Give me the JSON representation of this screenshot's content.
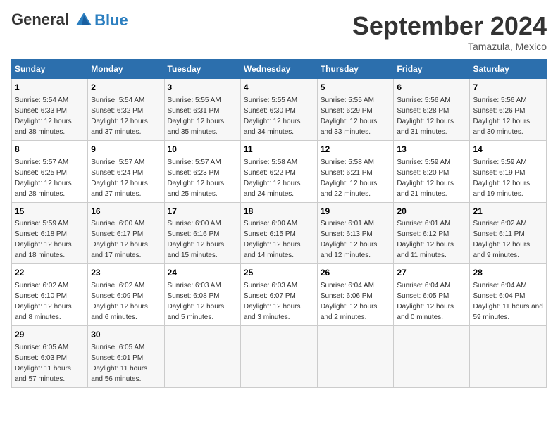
{
  "header": {
    "logo_line1": "General",
    "logo_line2": "Blue",
    "month": "September 2024",
    "location": "Tamazula, Mexico"
  },
  "weekdays": [
    "Sunday",
    "Monday",
    "Tuesday",
    "Wednesday",
    "Thursday",
    "Friday",
    "Saturday"
  ],
  "weeks": [
    [
      {
        "day": "1",
        "sunrise": "5:54 AM",
        "sunset": "6:33 PM",
        "daylight": "12 hours and 38 minutes."
      },
      {
        "day": "2",
        "sunrise": "5:54 AM",
        "sunset": "6:32 PM",
        "daylight": "12 hours and 37 minutes."
      },
      {
        "day": "3",
        "sunrise": "5:55 AM",
        "sunset": "6:31 PM",
        "daylight": "12 hours and 35 minutes."
      },
      {
        "day": "4",
        "sunrise": "5:55 AM",
        "sunset": "6:30 PM",
        "daylight": "12 hours and 34 minutes."
      },
      {
        "day": "5",
        "sunrise": "5:55 AM",
        "sunset": "6:29 PM",
        "daylight": "12 hours and 33 minutes."
      },
      {
        "day": "6",
        "sunrise": "5:56 AM",
        "sunset": "6:28 PM",
        "daylight": "12 hours and 31 minutes."
      },
      {
        "day": "7",
        "sunrise": "5:56 AM",
        "sunset": "6:26 PM",
        "daylight": "12 hours and 30 minutes."
      }
    ],
    [
      {
        "day": "8",
        "sunrise": "5:57 AM",
        "sunset": "6:25 PM",
        "daylight": "12 hours and 28 minutes."
      },
      {
        "day": "9",
        "sunrise": "5:57 AM",
        "sunset": "6:24 PM",
        "daylight": "12 hours and 27 minutes."
      },
      {
        "day": "10",
        "sunrise": "5:57 AM",
        "sunset": "6:23 PM",
        "daylight": "12 hours and 25 minutes."
      },
      {
        "day": "11",
        "sunrise": "5:58 AM",
        "sunset": "6:22 PM",
        "daylight": "12 hours and 24 minutes."
      },
      {
        "day": "12",
        "sunrise": "5:58 AM",
        "sunset": "6:21 PM",
        "daylight": "12 hours and 22 minutes."
      },
      {
        "day": "13",
        "sunrise": "5:59 AM",
        "sunset": "6:20 PM",
        "daylight": "12 hours and 21 minutes."
      },
      {
        "day": "14",
        "sunrise": "5:59 AM",
        "sunset": "6:19 PM",
        "daylight": "12 hours and 19 minutes."
      }
    ],
    [
      {
        "day": "15",
        "sunrise": "5:59 AM",
        "sunset": "6:18 PM",
        "daylight": "12 hours and 18 minutes."
      },
      {
        "day": "16",
        "sunrise": "6:00 AM",
        "sunset": "6:17 PM",
        "daylight": "12 hours and 17 minutes."
      },
      {
        "day": "17",
        "sunrise": "6:00 AM",
        "sunset": "6:16 PM",
        "daylight": "12 hours and 15 minutes."
      },
      {
        "day": "18",
        "sunrise": "6:00 AM",
        "sunset": "6:15 PM",
        "daylight": "12 hours and 14 minutes."
      },
      {
        "day": "19",
        "sunrise": "6:01 AM",
        "sunset": "6:13 PM",
        "daylight": "12 hours and 12 minutes."
      },
      {
        "day": "20",
        "sunrise": "6:01 AM",
        "sunset": "6:12 PM",
        "daylight": "12 hours and 11 minutes."
      },
      {
        "day": "21",
        "sunrise": "6:02 AM",
        "sunset": "6:11 PM",
        "daylight": "12 hours and 9 minutes."
      }
    ],
    [
      {
        "day": "22",
        "sunrise": "6:02 AM",
        "sunset": "6:10 PM",
        "daylight": "12 hours and 8 minutes."
      },
      {
        "day": "23",
        "sunrise": "6:02 AM",
        "sunset": "6:09 PM",
        "daylight": "12 hours and 6 minutes."
      },
      {
        "day": "24",
        "sunrise": "6:03 AM",
        "sunset": "6:08 PM",
        "daylight": "12 hours and 5 minutes."
      },
      {
        "day": "25",
        "sunrise": "6:03 AM",
        "sunset": "6:07 PM",
        "daylight": "12 hours and 3 minutes."
      },
      {
        "day": "26",
        "sunrise": "6:04 AM",
        "sunset": "6:06 PM",
        "daylight": "12 hours and 2 minutes."
      },
      {
        "day": "27",
        "sunrise": "6:04 AM",
        "sunset": "6:05 PM",
        "daylight": "12 hours and 0 minutes."
      },
      {
        "day": "28",
        "sunrise": "6:04 AM",
        "sunset": "6:04 PM",
        "daylight": "11 hours and 59 minutes."
      }
    ],
    [
      {
        "day": "29",
        "sunrise": "6:05 AM",
        "sunset": "6:03 PM",
        "daylight": "11 hours and 57 minutes."
      },
      {
        "day": "30",
        "sunrise": "6:05 AM",
        "sunset": "6:01 PM",
        "daylight": "11 hours and 56 minutes."
      },
      null,
      null,
      null,
      null,
      null
    ]
  ]
}
